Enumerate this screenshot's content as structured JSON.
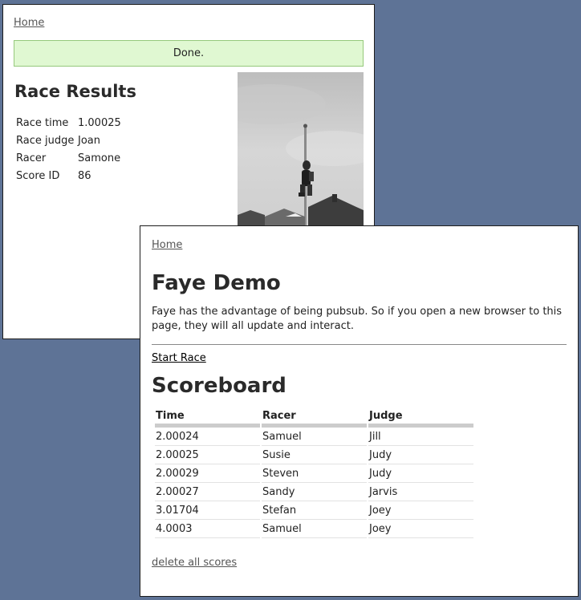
{
  "results_window": {
    "home_link": "Home",
    "flash": "Done.",
    "title": "Race Results",
    "details": [
      {
        "key": "Race time",
        "value": "1.00025"
      },
      {
        "key": "Race judge",
        "value": "Joan"
      },
      {
        "key": "Racer",
        "value": "Samone"
      },
      {
        "key": "Score ID",
        "value": "86"
      }
    ]
  },
  "demo_window": {
    "home_link": "Home",
    "title": "Faye Demo",
    "intro": "Faye has the advantage of being pubsub. So if you open a new browser to this page, they will all update and interact.",
    "start_link": "Start Race",
    "scoreboard_title": "Scoreboard",
    "columns": [
      "Time",
      "Racer",
      "Judge"
    ],
    "rows": [
      [
        "2.00024",
        "Samuel",
        "Jill"
      ],
      [
        "2.00025",
        "Susie",
        "Judy"
      ],
      [
        "2.00029",
        "Steven",
        "Judy"
      ],
      [
        "2.00027",
        "Sandy",
        "Jarvis"
      ],
      [
        "3.01704",
        "Stefan",
        "Joey"
      ],
      [
        "4.0003",
        "Samuel",
        "Joey"
      ]
    ],
    "delete_link": "delete all scores"
  },
  "colors": {
    "desktop": "#5e7396",
    "flash_bg": "#e0f8d2",
    "flash_border": "#96c97c"
  }
}
